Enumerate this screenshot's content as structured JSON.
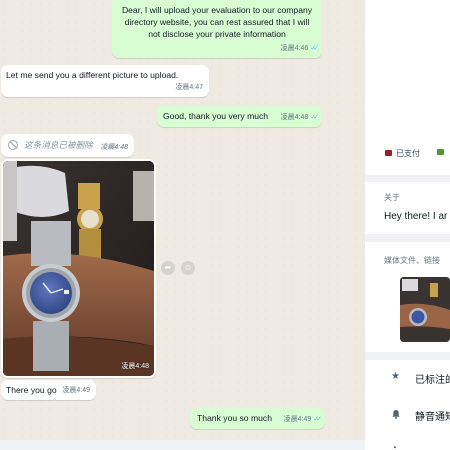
{
  "chat": {
    "messages": [
      {
        "id": "b1",
        "direction": "outgoing",
        "text": "Dear, I will upload your evaluation to our company directory website, you can rest assured that I will not disclose your private information",
        "time": "凌晨4:46",
        "read": true
      },
      {
        "id": "b2",
        "direction": "incoming",
        "text": "Let me send you a different picture to upload.",
        "time": "凌晨4:47"
      },
      {
        "id": "b3",
        "direction": "outgoing",
        "text": "Good, thank you very much",
        "time": "凌晨4:48",
        "read": true
      },
      {
        "id": "b4",
        "direction": "incoming",
        "text": "这条消息已被删除",
        "time": "凌晨4:48",
        "deleted": true
      },
      {
        "id": "b5",
        "direction": "incoming",
        "type": "image",
        "time": "凌晨4:48"
      },
      {
        "id": "b6",
        "direction": "incoming",
        "text": "There you go",
        "time": "凌晨4:49"
      },
      {
        "id": "b7",
        "direction": "outgoing",
        "text": "Thank you so much",
        "time": "凌晨4:49",
        "read": true
      }
    ],
    "icons": {
      "forward": "forward-icon",
      "react": "emoji-icon",
      "deleted": "block-icon",
      "read": "double-check-icon"
    }
  },
  "sidebar": {
    "labels": [
      {
        "text": "已支付",
        "color": "#9b1c2e"
      },
      {
        "text": "",
        "color": "#4a9a2e"
      }
    ],
    "about": {
      "title": "关于",
      "text": "Hey there! I ar"
    },
    "media": {
      "title": "媒体文件、链接"
    },
    "actions": [
      {
        "icon": "star-icon",
        "label": "已标注的"
      },
      {
        "icon": "bell-icon",
        "label": "静音通知"
      }
    ]
  },
  "colors": {
    "outgoing": "#d9fdd3",
    "incoming": "#ffffff",
    "ticks": "#53bdeb",
    "meta": "#667781"
  }
}
